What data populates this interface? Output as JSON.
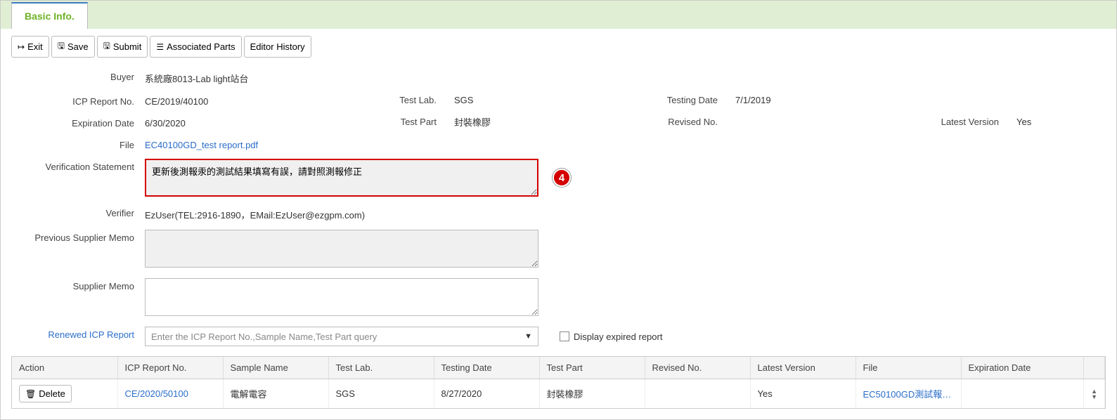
{
  "tab": {
    "label": "Basic Info."
  },
  "toolbar": {
    "exit": "Exit",
    "save": "Save",
    "submit": "Submit",
    "associated_parts": "Associated Parts",
    "editor_history": "Editor History"
  },
  "labels": {
    "buyer": "Buyer",
    "icp_report_no": "ICP Report No.",
    "test_lab": "Test Lab.",
    "testing_date": "Testing Date",
    "expiration_date": "Expiration Date",
    "test_part": "Test Part",
    "revised_no": "Revised No.",
    "latest_version": "Latest Version",
    "file": "File",
    "verification_statement": "Verification Statement",
    "verifier": "Verifier",
    "previous_supplier_memo": "Previous Supplier Memo",
    "supplier_memo": "Supplier Memo",
    "renewed_icp_report": "Renewed ICP Report",
    "display_expired_report": "Display expired report"
  },
  "values": {
    "buyer": "系統廠8013-Lab light站台",
    "icp_report_no": "CE/2019/40100",
    "test_lab": "SGS",
    "testing_date": "7/1/2019",
    "expiration_date": "6/30/2020",
    "test_part": "封裝橡膠",
    "revised_no": "",
    "latest_version": "Yes",
    "file": "EC40100GD_test report.pdf",
    "verification_statement": "更新後測報汞的測試結果填寫有誤，請對照測報修正",
    "verifier": "EzUser(TEL:2916-1890，EMail:EzUser@ezgpm.com)",
    "previous_supplier_memo": "",
    "supplier_memo": "",
    "combo_placeholder": "Enter the ICP Report No.,Sample Name,Test Part query"
  },
  "badge": "4",
  "table": {
    "headers": {
      "action": "Action",
      "icp_report_no": "ICP Report No.",
      "sample_name": "Sample Name",
      "test_lab": "Test Lab.",
      "testing_date": "Testing Date",
      "test_part": "Test Part",
      "revised_no": "Revised No.",
      "latest_version": "Latest Version",
      "file": "File",
      "expiration_date": "Expiration Date"
    },
    "row": {
      "delete": "Delete",
      "icp_report_no": "CE/2020/50100",
      "sample_name": "電解電容",
      "test_lab": "SGS",
      "testing_date": "8/27/2020",
      "test_part": "封裝橡膠",
      "revised_no": "",
      "latest_version": "Yes",
      "file": "EC50100GD測試報…",
      "expiration_date": ""
    }
  }
}
